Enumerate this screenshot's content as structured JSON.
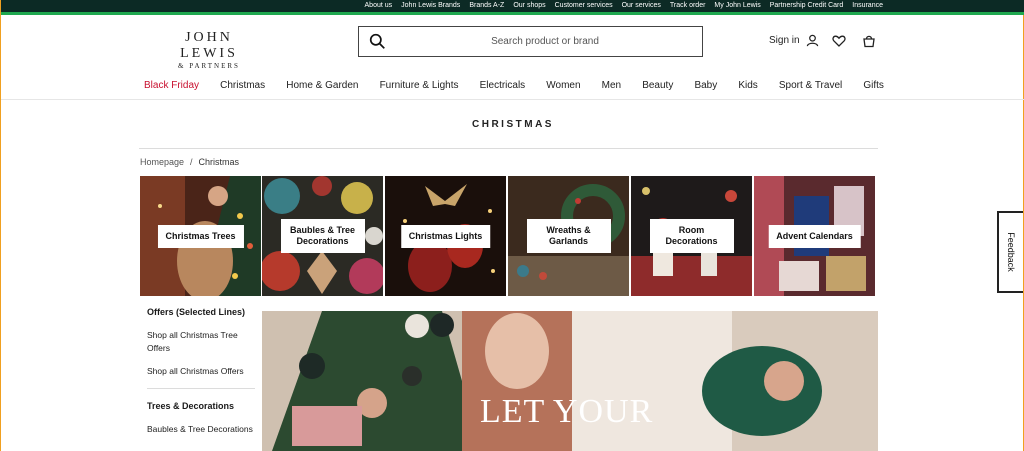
{
  "top_links": [
    "About us",
    "John Lewis Brands",
    "Brands A-Z",
    "Our shops",
    "Customer services",
    "Our services",
    "Track order",
    "My John Lewis",
    "Partnership Credit Card",
    "Insurance"
  ],
  "logo": {
    "line1": "JOHN LEWIS",
    "line2": "& PARTNERS"
  },
  "search": {
    "placeholder": "Search product or brand"
  },
  "account": {
    "signin_label": "Sign in"
  },
  "icons": [
    "search-icon",
    "user-icon",
    "heart-icon",
    "basket-icon"
  ],
  "nav": {
    "items": [
      "Black Friday",
      "Christmas",
      "Home & Garden",
      "Furniture & Lights",
      "Electricals",
      "Women",
      "Men",
      "Beauty",
      "Baby",
      "Kids",
      "Sport & Travel",
      "Gifts"
    ]
  },
  "page": {
    "title": "CHRISTMAS",
    "breadcrumb": {
      "home": "Homepage",
      "separator": "/",
      "current": "Christmas"
    }
  },
  "tiles": [
    {
      "lines": [
        "Christmas Trees"
      ]
    },
    {
      "lines": [
        "Baubles & Tree",
        "Decorations"
      ]
    },
    {
      "lines": [
        "Christmas Lights"
      ]
    },
    {
      "lines": [
        "Wreaths &",
        "Garlands"
      ]
    },
    {
      "lines": [
        "Room",
        "Decorations"
      ]
    },
    {
      "lines": [
        "Advent Calendars"
      ]
    }
  ],
  "sidebar": {
    "sections": [
      {
        "heading": "Offers (Selected Lines)",
        "links": [
          "Shop all Christmas Tree Offers",
          "Shop all Christmas Offers"
        ]
      },
      {
        "heading": "Trees & Decorations",
        "links": [
          "Baubles & Tree Decorations"
        ]
      }
    ]
  },
  "hero": {
    "text": "LET YOUR"
  },
  "feedback": {
    "label": "Feedback"
  },
  "colors": {
    "top_bar": "#0c2a25",
    "accent_green": "#1fa84f",
    "sale_red": "#c8102e"
  }
}
